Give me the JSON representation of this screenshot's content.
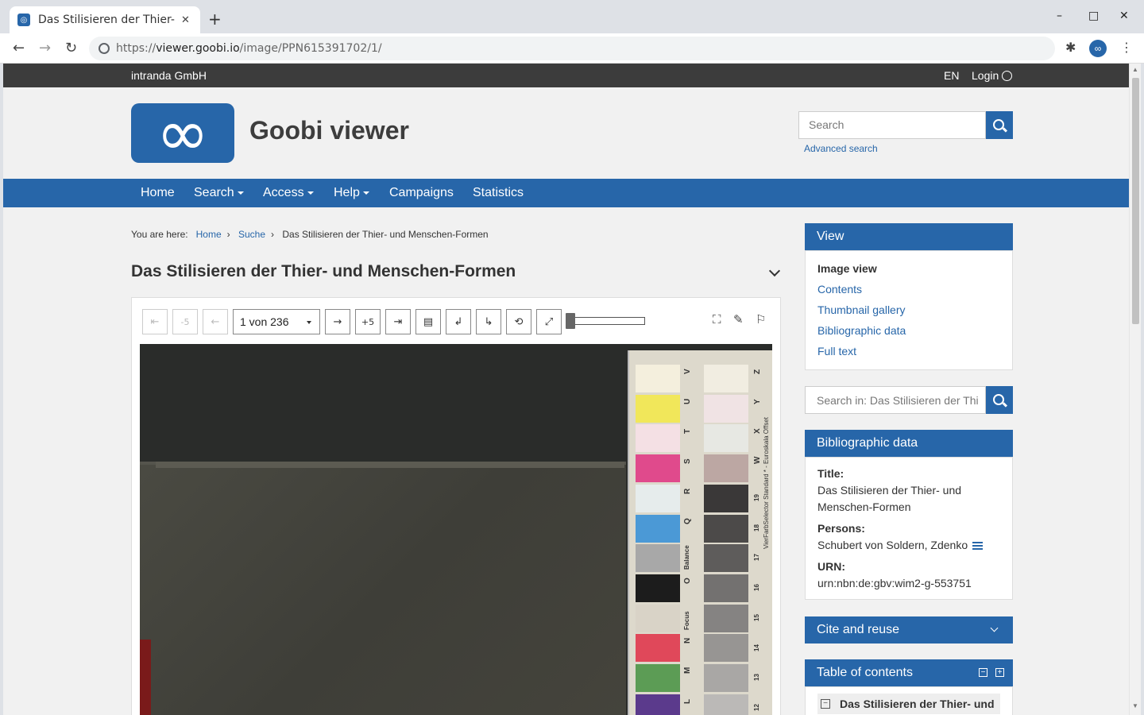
{
  "browser": {
    "tab_title": "Das Stilisieren der Thier- u",
    "url_prefix": "https://",
    "url_host": "viewer.goobi.io",
    "url_path": "/image/PPN615391702/1/",
    "new_tab": "+",
    "close_tab": "✕",
    "minimize": "–",
    "maximize": "□",
    "close_window": "✕"
  },
  "topbar": {
    "org": "intranda GmbH",
    "lang": "EN",
    "login": "Login"
  },
  "header": {
    "brand": "Goobi viewer",
    "logo_glyph": "∞",
    "search_placeholder": "Search",
    "advanced_search": "Advanced search"
  },
  "nav": {
    "items": [
      {
        "label": "Home"
      },
      {
        "label": "Search"
      },
      {
        "label": "Access"
      },
      {
        "label": "Help"
      },
      {
        "label": "Campaigns"
      },
      {
        "label": "Statistics"
      }
    ]
  },
  "breadcrumb": {
    "prefix": "You are here:",
    "items": [
      "Home",
      "Suche",
      "Das Stilisieren der Thier- und Menschen-Formen"
    ],
    "sep": "›"
  },
  "document": {
    "title": "Das Stilisieren der Thier- und Menschen-Formen"
  },
  "viewer": {
    "first": "⇤",
    "minus5": "-5",
    "prev": "←",
    "page_select": "1 von 236",
    "next": "→",
    "plus5": "+5",
    "last": "⇥",
    "zoom_slider_value": 0,
    "colorcard": {
      "left_letters": [
        "V",
        "U",
        "T",
        "S",
        "R",
        "Q",
        "Balance",
        "O",
        "Focus",
        "N",
        "M",
        "L"
      ],
      "right_letters": [
        "Z",
        "Y",
        "X",
        "W"
      ],
      "right_numbers": [
        "19",
        "18",
        "17",
        "16",
        "15",
        "14",
        "13",
        "12"
      ],
      "vertical_text": "VierFarbSelector Standard * - Euroskala Offset",
      "left_colors": [
        "#f4efdd",
        "#f1e75a",
        "#f4e0e4",
        "#e04a8c",
        "#e6ecec",
        "#4b99d6",
        "#a8a8a8",
        "#1c1c1c",
        "#d9d3c7",
        "#e0485a",
        "#5c9c55",
        "#5b3a8c"
      ],
      "right_colors": [
        "#f1ede1",
        "#f0e3e4",
        "#e7e8e3",
        "#bca7a3",
        "#3a3838",
        "#4c4a49",
        "#5e5c5b",
        "#737170",
        "#858382",
        "#979593",
        "#a9a7a5",
        "#bbb9b7"
      ]
    }
  },
  "sidebar": {
    "view": {
      "title": "View",
      "items": [
        "Image view",
        "Contents",
        "Thumbnail gallery",
        "Bibliographic data",
        "Full text"
      ]
    },
    "search_in_placeholder": "Search in: Das Stilisieren der Thi",
    "bibliographic": {
      "title": "Bibliographic data",
      "title_label": "Title:",
      "title_value": "Das Stilisieren der Thier- und Menschen-Formen",
      "persons_label": "Persons:",
      "persons_value": "Schubert von Soldern, Zdenko",
      "urn_label": "URN:",
      "urn_value": "urn:nbn:de:gbv:wim2-g-553751"
    },
    "cite": {
      "title": "Cite and reuse"
    },
    "toc": {
      "title": "Table of contents",
      "collapse": "−",
      "expand": "+",
      "first_entry": "Das Stilisieren der Thier- und"
    }
  }
}
